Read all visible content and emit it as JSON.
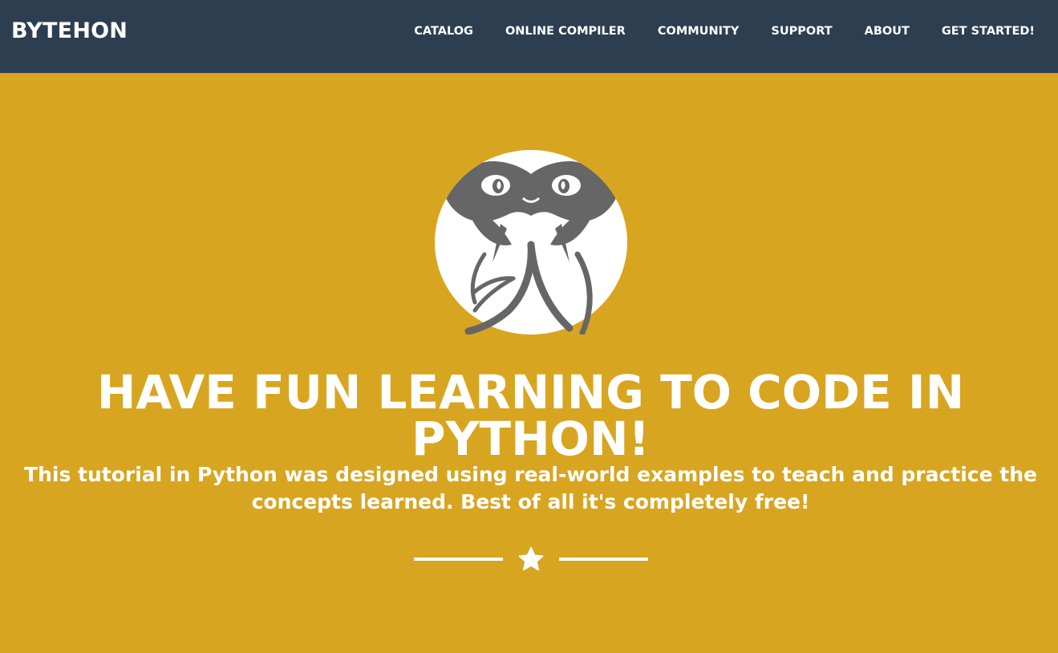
{
  "navbar": {
    "brand": "BYTEHON",
    "links": [
      {
        "label": "CATALOG"
      },
      {
        "label": "ONLINE COMPILER"
      },
      {
        "label": "COMMUNITY"
      },
      {
        "label": "SUPPORT"
      },
      {
        "label": "ABOUT"
      },
      {
        "label": "GET STARTED!"
      }
    ]
  },
  "masthead": {
    "avatar_icon": "python-snake-icon",
    "headline": "HAVE FUN LEARNING TO CODE IN PYTHON!",
    "subtitle": "This tutorial in Python was designed using real-world examples to teach and practice the concepts learned. Best of all it's completely free!",
    "divider_icon": "star-icon"
  },
  "colors": {
    "navbar_bg": "#2d3e50",
    "masthead_bg": "#d8a521",
    "text": "#ffffff",
    "snake": "#666666"
  }
}
